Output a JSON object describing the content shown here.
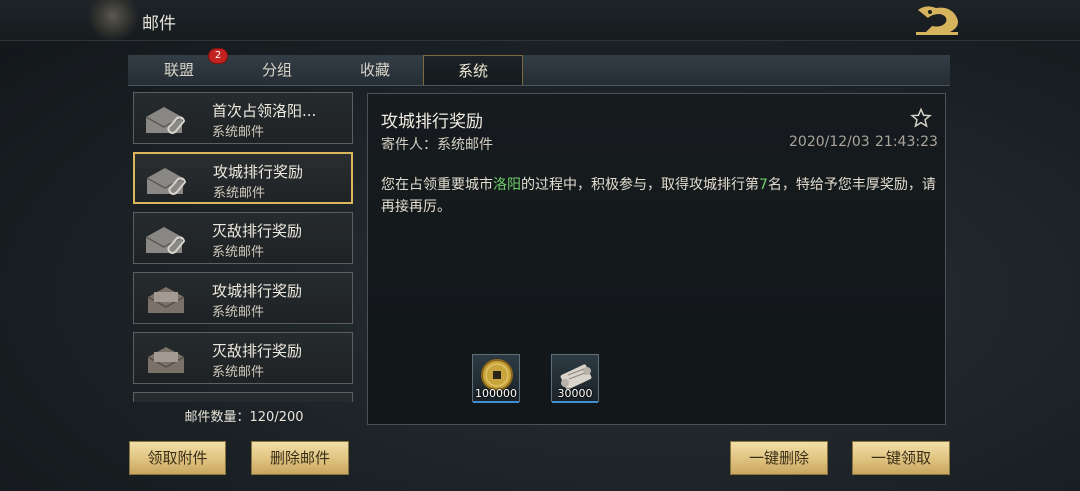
{
  "header": {
    "title": "邮件",
    "back_icon": "dragon-back-icon"
  },
  "tabs": [
    {
      "label": "联盟",
      "badge": "2"
    },
    {
      "label": "分组"
    },
    {
      "label": "收藏"
    },
    {
      "label": "系统",
      "active": true
    }
  ],
  "mail_list": {
    "items": [
      {
        "subject": "首次占领洛阳...",
        "sender": "系统邮件",
        "state": "opened-attachment"
      },
      {
        "subject": "攻城排行奖励",
        "sender": "系统邮件",
        "state": "opened-attachment",
        "selected": true
      },
      {
        "subject": "灭敌排行奖励",
        "sender": "系统邮件",
        "state": "opened-attachment"
      },
      {
        "subject": "攻城排行奖励",
        "sender": "系统邮件",
        "state": "opened"
      },
      {
        "subject": "灭敌排行奖励",
        "sender": "系统邮件",
        "state": "opened"
      }
    ],
    "count_label": "邮件数量：",
    "count_value": "120/200"
  },
  "detail": {
    "title": "攻城排行奖励",
    "sender_label": "寄件人：系统邮件",
    "date": "2020/12/03",
    "time": "21:43:23",
    "body_pre": "您在占领重要城市",
    "body_city": "洛阳",
    "body_mid": "的过程中，积极参与，取得攻城排行第",
    "body_rank": "7",
    "body_post": "名，特给予您丰厚奖励，请再接再厉。",
    "rewards": [
      {
        "icon": "copper-coin-icon",
        "qty": "100000"
      },
      {
        "icon": "scroll-icon",
        "qty": "30000"
      }
    ]
  },
  "buttons": {
    "collect_attachments": "领取附件",
    "delete_mail": "删除邮件",
    "delete_all": "一键删除",
    "collect_all": "一键领取"
  },
  "colors": {
    "accent_gold": "#d9b75a",
    "highlight_green": "#6fd06a",
    "badge_red": "#c2231f"
  }
}
